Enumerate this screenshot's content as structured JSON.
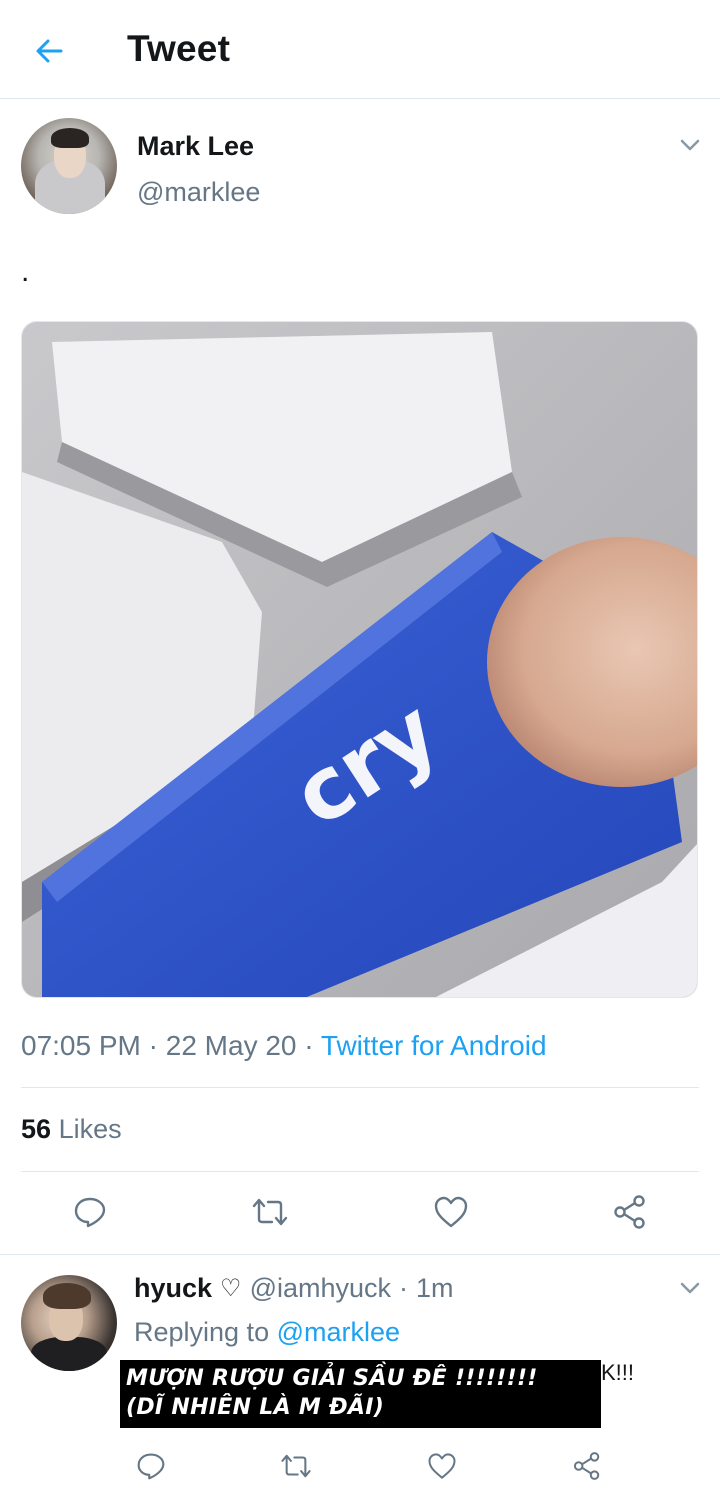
{
  "header": {
    "title": "Tweet"
  },
  "tweet": {
    "author_name": "Mark Lee",
    "author_handle": "@marklee",
    "text": ".",
    "media": {
      "key_label": "cry"
    },
    "time": "07:05 PM",
    "date": "22 May 20",
    "source": "Twitter for Android",
    "likes_count": "56",
    "likes_label": "Likes"
  },
  "reply": {
    "name": "hyuck",
    "name_emoji": "♡",
    "handle": "@iamhyuck",
    "separator": "·",
    "time": "1m",
    "replying_prefix": "Replying to",
    "replying_mention": "@marklee",
    "image_line1": "MƯỢN RƯỢU GIẢI SẦU ĐÊ !!!!!!!!",
    "image_line2": "(DĨ NHIÊN LÀ M ĐÃI)",
    "text_suffix": "K!!!"
  },
  "colors": {
    "accent": "#1da1f2",
    "secondary_text": "#657786",
    "divider": "#e1e8ed"
  },
  "icons": {
    "back": "back-arrow-icon",
    "chevron": "chevron-down-icon",
    "reply": "reply-icon",
    "retweet": "retweet-icon",
    "like": "heart-icon",
    "share": "share-icon"
  }
}
